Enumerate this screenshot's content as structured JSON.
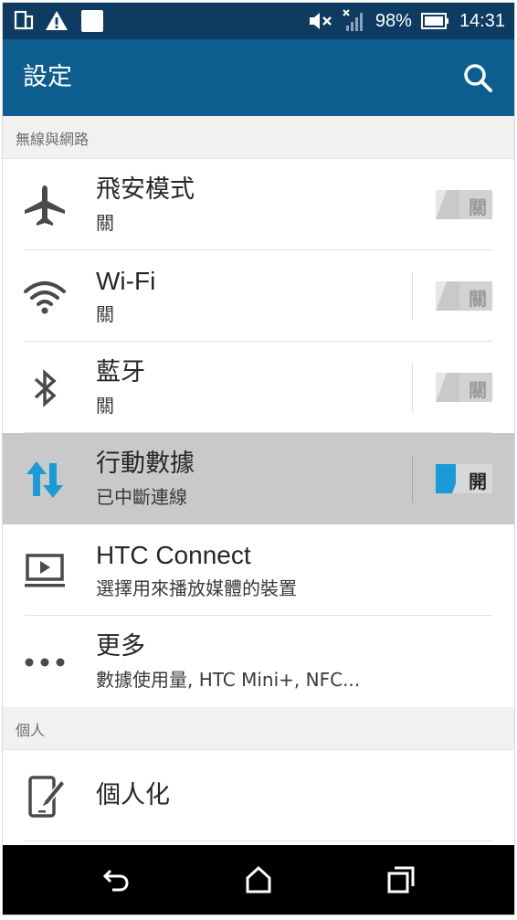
{
  "status_bar": {
    "battery_percent": "98%",
    "time": "14:31",
    "icons": [
      "sim-icon",
      "warning-icon",
      "notification-square-icon",
      "mute-icon",
      "signal-no-service-icon",
      "battery-icon"
    ]
  },
  "app_bar": {
    "title": "設定",
    "search_icon": "search-icon"
  },
  "sections": {
    "wireless": {
      "header": "無線與網路",
      "items": [
        {
          "title": "飛安模式",
          "subtitle": "關",
          "icon": "airplane-icon",
          "switch_label": "關",
          "switch_on": false
        },
        {
          "title": "Wi-Fi",
          "subtitle": "關",
          "icon": "wifi-icon",
          "switch_label": "關",
          "switch_on": false
        },
        {
          "title": "藍牙",
          "subtitle": "關",
          "icon": "bluetooth-icon",
          "switch_label": "關",
          "switch_on": false
        },
        {
          "title": "行動數據",
          "subtitle": "已中斷連線",
          "icon": "data-arrows-icon",
          "switch_label": "開",
          "switch_on": true
        },
        {
          "title": "HTC Connect",
          "subtitle": "選擇用來播放媒體的裝置",
          "icon": "cast-screen-icon"
        },
        {
          "title": "更多",
          "subtitle": "數據使用量, HTC Mini+, NFC...",
          "icon": "more-dots-icon"
        }
      ]
    },
    "personal": {
      "header": "個人",
      "items": [
        {
          "title": "個人化",
          "icon": "personalize-icon"
        }
      ]
    }
  },
  "nav_bar": {
    "icons": [
      "back-icon",
      "home-icon",
      "recents-icon"
    ]
  },
  "colors": {
    "status_bar": "#0d3b61",
    "app_bar": "#0e5d8f",
    "accent": "#1a9bd7",
    "highlight_row": "#c9c9c9",
    "section_header": "#f1f2f0"
  }
}
